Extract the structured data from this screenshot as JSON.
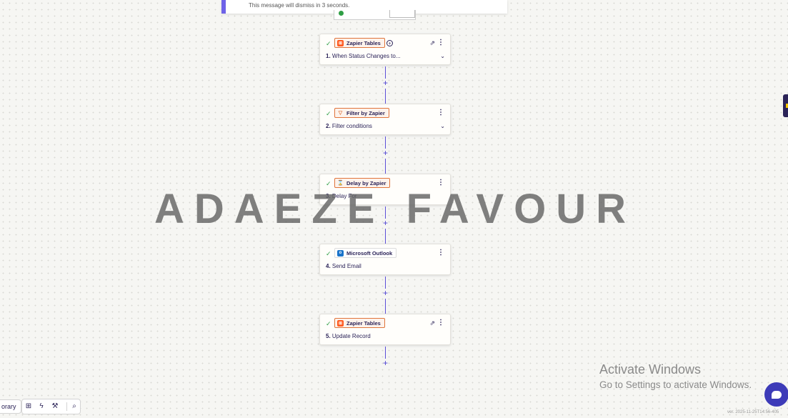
{
  "toast": {
    "message": "This message will dismiss in 3 seconds."
  },
  "steps": [
    {
      "number": "1.",
      "title": "When Status Changes to...",
      "app": "Zapier Tables",
      "app_icon": "zapier-tables-icon",
      "status": "check-icon"
    },
    {
      "number": "2.",
      "title": "Filter conditions",
      "app": "Filter by Zapier",
      "app_icon": "filter-icon",
      "status": "check-icon"
    },
    {
      "number": "3.",
      "title": "Delay For",
      "app": "Delay by Zapier",
      "app_icon": "delay-icon",
      "status": "check-icon"
    },
    {
      "number": "4.",
      "title": "Send Email",
      "app": "Microsoft Outlook",
      "app_icon": "outlook-icon",
      "status": "check-icon"
    },
    {
      "number": "5.",
      "title": "Update Record",
      "app": "Zapier Tables",
      "app_icon": "zapier-tables-icon",
      "status": "check-icon"
    }
  ],
  "watermark": "ADAEZE FAVOUR",
  "windows": {
    "title": "Activate Windows",
    "subtitle": "Go to Settings to activate Windows."
  },
  "version": "ver. 2025-11-25T14:56-405",
  "bottom": {
    "library_label": "orary"
  },
  "colors": {
    "accent": "#5b4fd8",
    "badge_border": "#e0743b",
    "success": "#2f9e44",
    "text": "#2b2358"
  }
}
